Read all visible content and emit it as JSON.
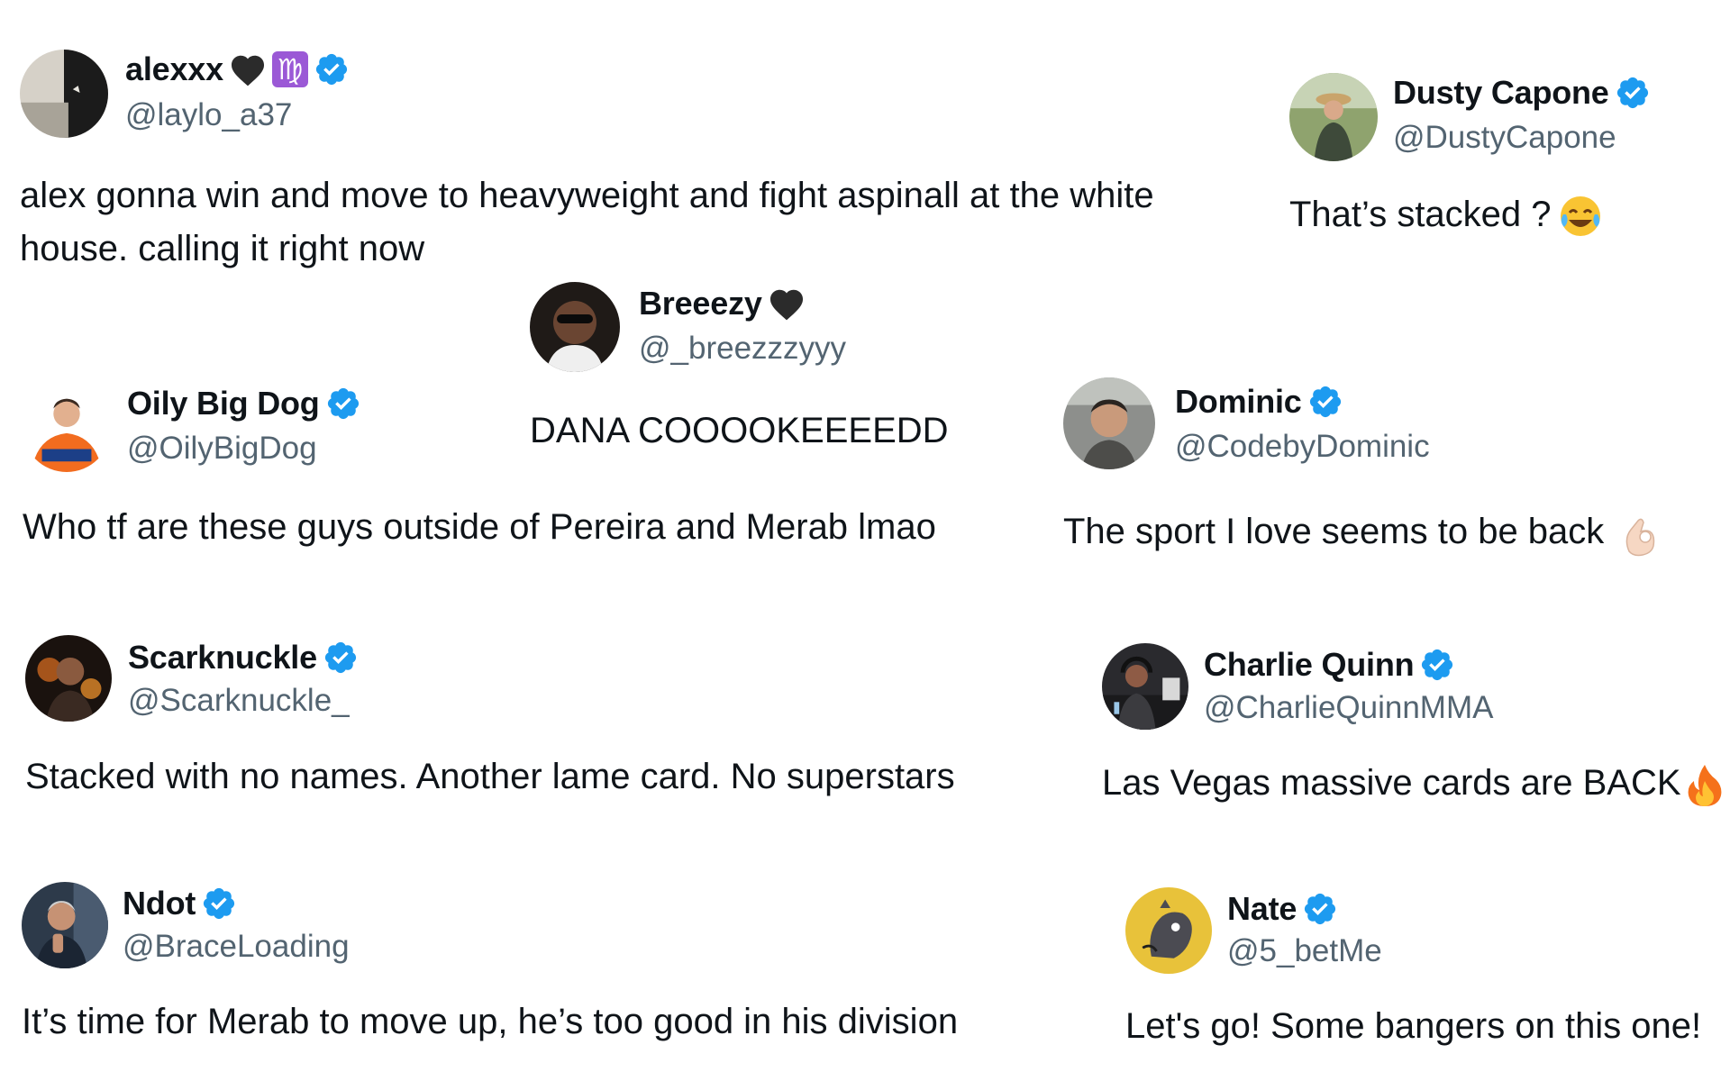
{
  "tweets": [
    {
      "display_name": "alexxx",
      "handle": "@laylo_a37",
      "text": "alex gonna win and move to heavyweight and fight aspinall at the white house. calling it right now",
      "zodiac": "♍"
    },
    {
      "display_name": "Dusty Capone",
      "handle": "@DustyCapone",
      "text": "That’s stacked ?"
    },
    {
      "display_name": "Breeezy",
      "handle": "@_breezzzyyy",
      "text": "DANA COOOOKEEEEDD"
    },
    {
      "display_name": "Oily Big Dog",
      "handle": "@OilyBigDog",
      "text": "Who tf are these guys outside of Pereira and Merab lmao"
    },
    {
      "display_name": "Dominic",
      "handle": "@CodebyDominic",
      "text": "The sport I love seems to be back"
    },
    {
      "display_name": "Scarknuckle",
      "handle": "@Scarknuckle_",
      "text": "Stacked with no names. Another lame card. No superstars"
    },
    {
      "display_name": "Charlie Quinn",
      "handle": "@CharlieQuinnMMA",
      "text": "Las Vegas massive cards are BACK"
    },
    {
      "display_name": "Ndot",
      "handle": "@BraceLoading",
      "text": "It’s time for Merab to move up, he’s too good in his division"
    },
    {
      "display_name": "Nate",
      "handle": "@5_betMe",
      "text": "Let's go! Some bangers on this one!"
    }
  ],
  "icons": {
    "verified_badge": "verified-badge-icon",
    "black_heart": "black-heart-icon",
    "laughing_emoji": "tears-of-joy-emoji",
    "ok_hand_emoji": "ok-hand-emoji",
    "fire_emoji": "fire-emoji"
  },
  "colors": {
    "text_primary": "#0f1419",
    "text_secondary": "#536471",
    "verified_blue": "#1d9bf0",
    "zodiac_purple": "#9b59d6"
  }
}
